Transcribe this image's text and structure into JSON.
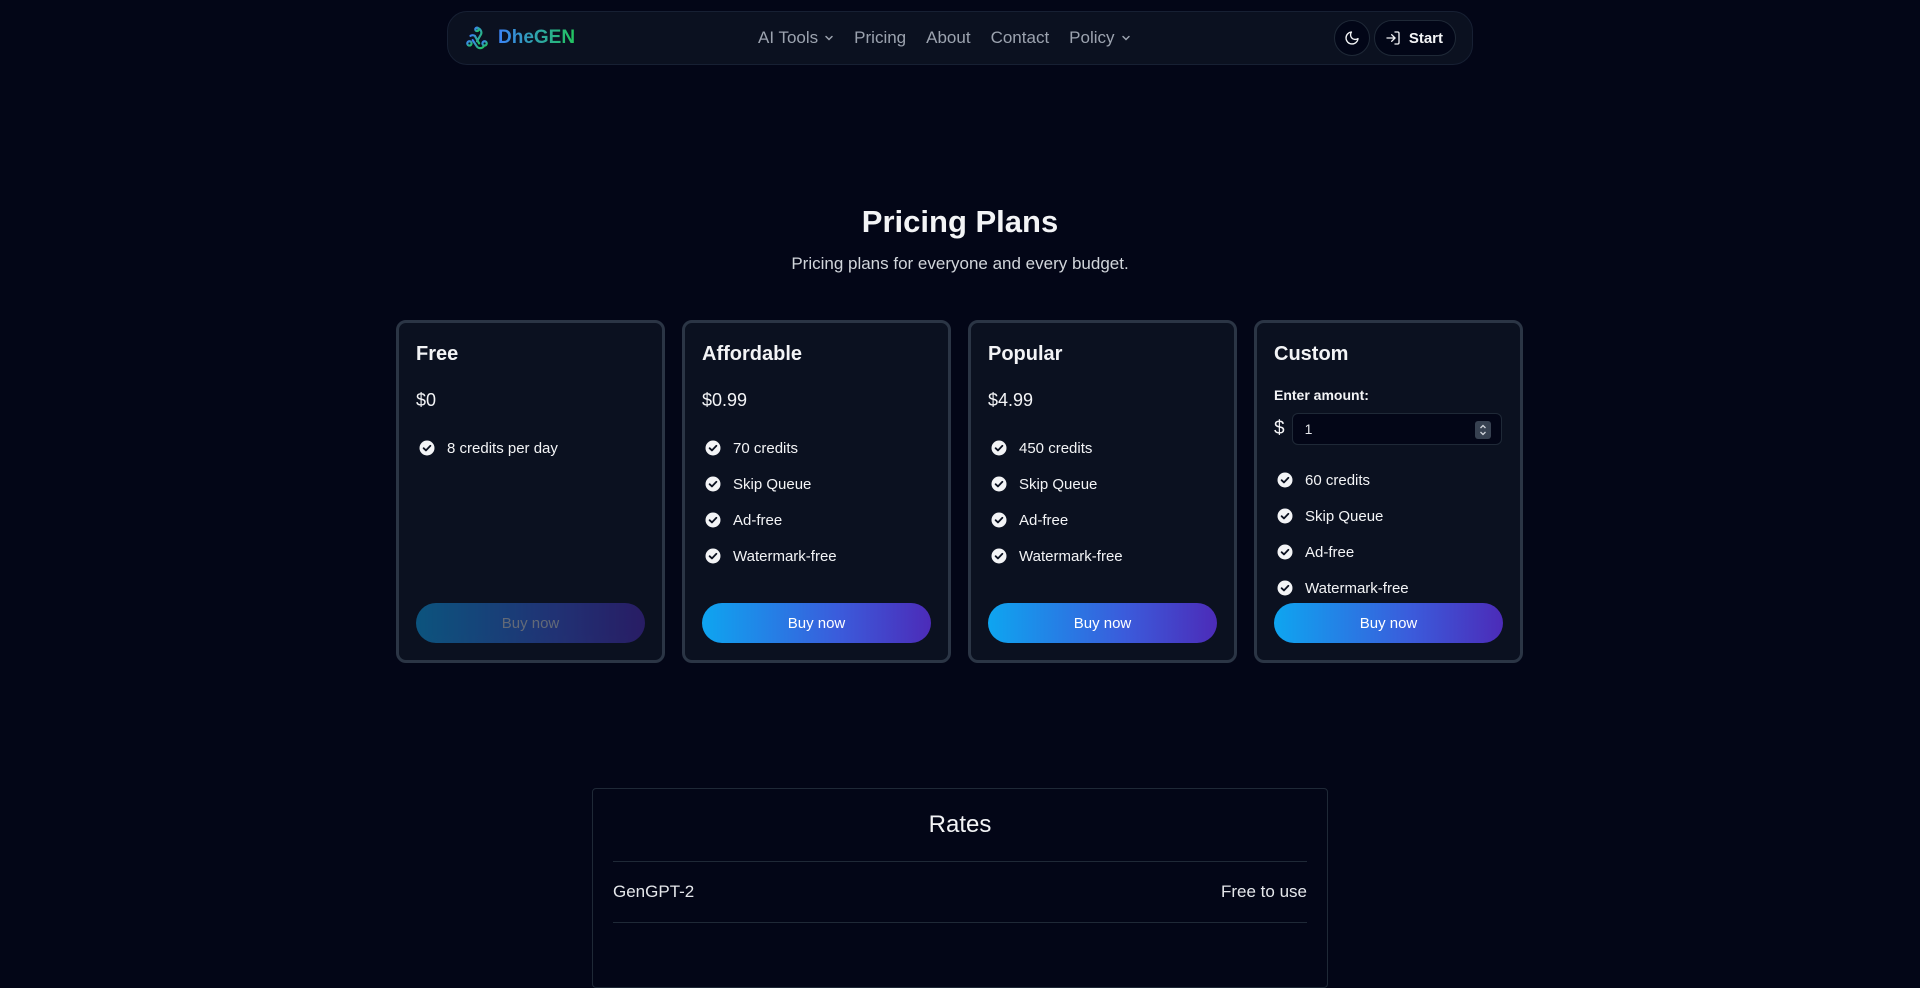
{
  "nav": {
    "brand": "DheGEN",
    "links": [
      {
        "label": "AI Tools",
        "has_dropdown": true
      },
      {
        "label": "Pricing",
        "has_dropdown": false
      },
      {
        "label": "About",
        "has_dropdown": false
      },
      {
        "label": "Contact",
        "has_dropdown": false
      },
      {
        "label": "Policy",
        "has_dropdown": true
      }
    ],
    "theme_toggle_icon": "moon-icon",
    "start_label": "Start",
    "start_icon": "sign-in-icon"
  },
  "hero": {
    "title": "Pricing Plans",
    "subtitle": "Pricing plans for everyone and every budget."
  },
  "plans": [
    {
      "name": "Free",
      "price": "$0",
      "features": [
        "8 credits per day"
      ],
      "button": "Buy now",
      "button_disabled": true
    },
    {
      "name": "Affordable",
      "price": "$0.99",
      "features": [
        "70 credits",
        "Skip Queue",
        "Ad-free",
        "Watermark-free"
      ],
      "button": "Buy now",
      "button_disabled": false
    },
    {
      "name": "Popular",
      "price": "$4.99",
      "features": [
        "450 credits",
        "Skip Queue",
        "Ad-free",
        "Watermark-free"
      ],
      "button": "Buy now",
      "button_disabled": false
    },
    {
      "name": "Custom",
      "amount_label": "Enter amount:",
      "currency_symbol": "$",
      "amount_value": "1",
      "features": [
        "60 credits",
        "Skip Queue",
        "Ad-free",
        "Watermark-free"
      ],
      "button": "Buy now",
      "button_disabled": false
    }
  ],
  "rates": {
    "title": "Rates",
    "rows": [
      {
        "model": "GenGPT-2",
        "rate": "Free to use"
      }
    ]
  },
  "colors": {
    "background": "#030617",
    "card": "#0b1120",
    "card_border": "#2b3545",
    "button_gradient_start": "#0ea5f0",
    "button_gradient_end": "#4c2bb8"
  }
}
